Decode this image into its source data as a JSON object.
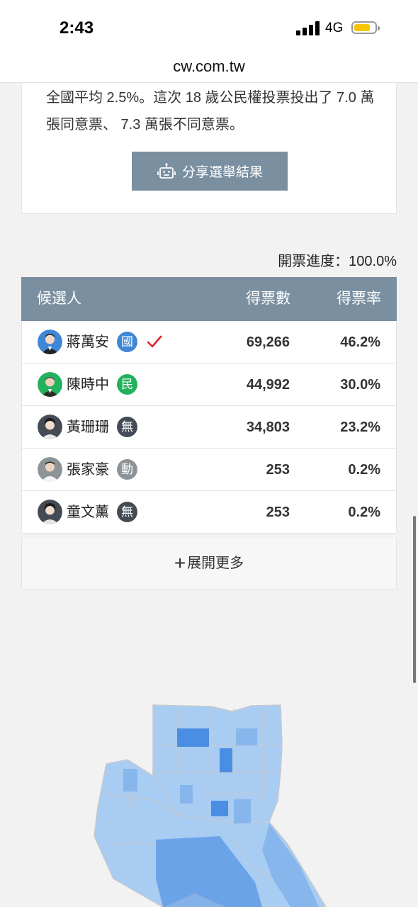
{
  "status": {
    "time": "2:43",
    "network": "4G"
  },
  "browser": {
    "url": "cw.com.tw"
  },
  "summary": {
    "text": "全國平均 2.5%。這次 18 歲公民權投票投出了 7.0 萬張同意票、 7.3 萬張不同意票。",
    "share_label": "分享選舉結果"
  },
  "results": {
    "progress": "開票進度：100.0%",
    "headers": {
      "name": "候選人",
      "votes": "得票數",
      "rate": "得票率"
    },
    "candidates": [
      {
        "name": "蔣萬安",
        "party": "國",
        "party_color": "#3f87d6",
        "votes": "69,266",
        "rate": "46.2%",
        "elected": true
      },
      {
        "name": "陳時中",
        "party": "民",
        "party_color": "#23b15d",
        "votes": "44,992",
        "rate": "30.0%",
        "elected": false
      },
      {
        "name": "黃珊珊",
        "party": "無",
        "party_color": "#444b54",
        "votes": "34,803",
        "rate": "23.2%",
        "elected": false
      },
      {
        "name": "張家豪",
        "party": "動",
        "party_color": "#8d9497",
        "votes": "253",
        "rate": "0.2%",
        "elected": false
      },
      {
        "name": "童文薰",
        "party": "無",
        "party_color": "#444b54",
        "votes": "253",
        "rate": "0.2%",
        "elected": false
      }
    ],
    "expand_label": "展開更多"
  },
  "colors": {
    "header_bg": "#7a8fa0",
    "elected_check": "#d9262c",
    "map_light": "#a9ccf2",
    "map_mid": "#86b6ec",
    "map_dark": "#4a8ee3"
  }
}
